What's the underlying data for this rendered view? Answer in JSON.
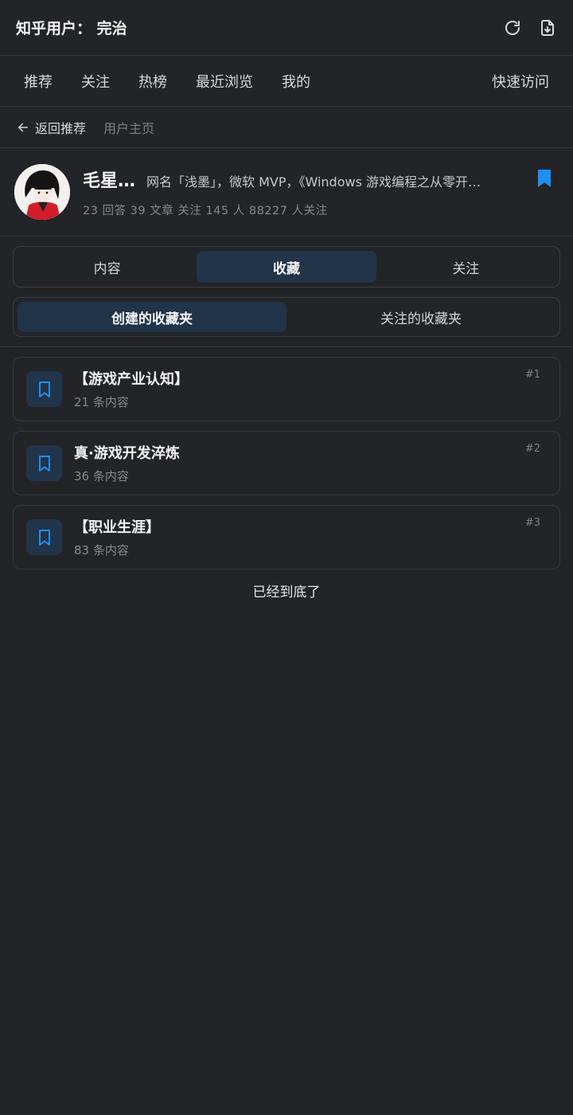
{
  "header": {
    "title": "知乎用户： 完治",
    "refresh_icon": "refresh-icon",
    "export_icon": "file-download-icon"
  },
  "nav": {
    "tabs": [
      "推荐",
      "关注",
      "热榜",
      "最近浏览",
      "我的"
    ],
    "quick_access": "快速访问"
  },
  "breadcrumb": {
    "back_label": "返回推荐",
    "current": "用户主页"
  },
  "profile": {
    "name": "毛星…",
    "bio": "网名「浅墨」，微软 MVP，《Windows 游戏编程之从零开…",
    "stats": "23 回答  39 文章  关注 145 人  88227 人关注",
    "bookmark_color": "#1e8ff2"
  },
  "tabs": {
    "items": [
      "内容",
      "收藏",
      "关注"
    ],
    "active": "收藏"
  },
  "subtabs": {
    "items": [
      "创建的收藏夹",
      "关注的收藏夹"
    ],
    "active": "创建的收藏夹"
  },
  "collections": [
    {
      "title": "【游戏产业认知】",
      "count": "21 条内容",
      "rank": "#1"
    },
    {
      "title": "真·游戏开发淬炼",
      "count": "36 条内容",
      "rank": "#2"
    },
    {
      "title": "【职业生涯】",
      "count": "83 条内容",
      "rank": "#3"
    }
  ],
  "footer": {
    "end_text": "已经到底了"
  },
  "colors": {
    "background": "#232428",
    "accent": "#1e8ff2",
    "active_tab_bg": "#213449"
  }
}
